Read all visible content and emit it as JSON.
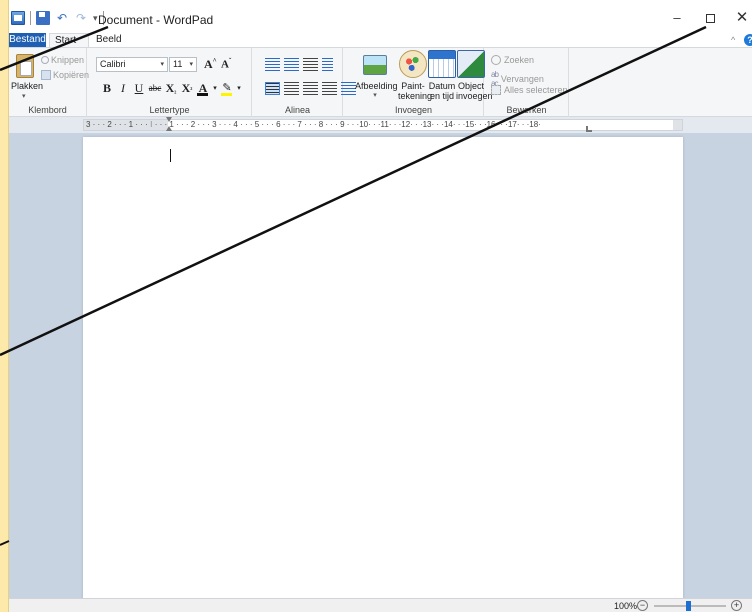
{
  "window": {
    "title": "Document - WordPad",
    "minimize": "–",
    "close": "✕"
  },
  "tabs": {
    "file": "Bestand",
    "start": "Start",
    "view": "Beeld",
    "help": "?",
    "collapse": "^"
  },
  "clipboard": {
    "paste": "Plakken",
    "cut": "Knippen",
    "copy": "Kopiëren",
    "group_label": "Klembord"
  },
  "font": {
    "family": "Calibri",
    "size": "11",
    "group_label": "Lettertype",
    "bold": "B",
    "italic": "I",
    "underline": "U",
    "strike": "abc",
    "color_letter": "A"
  },
  "paragraph": {
    "group_label": "Alinea"
  },
  "insert": {
    "picture": "Afbeelding",
    "paint_line1": "Paint-",
    "paint_line2": "tekening",
    "date_line1": "Datum",
    "date_line2": "en tijd",
    "object_line1": "Object",
    "object_line2": "invoegen",
    "group_label": "Invoegen"
  },
  "editing": {
    "find": "Zoeken",
    "replace": "Vervangen",
    "select_all": "Alles selecteren",
    "group_label": "Bewerken"
  },
  "ruler": {
    "marks": "3 · · · 2 · · · 1 · · · ⁝ · · · 1 · · · 2 · · · 3 · · · 4 · · · 5 · · · 6 · · · 7 · · · 8 · · · 9 · · ·10· · ·11· · ·12· · ·13· · ·14· · ·15· · ·16· · ·17· · ·18·"
  },
  "status": {
    "zoom": "100%",
    "zoom_level_percent": 100
  }
}
